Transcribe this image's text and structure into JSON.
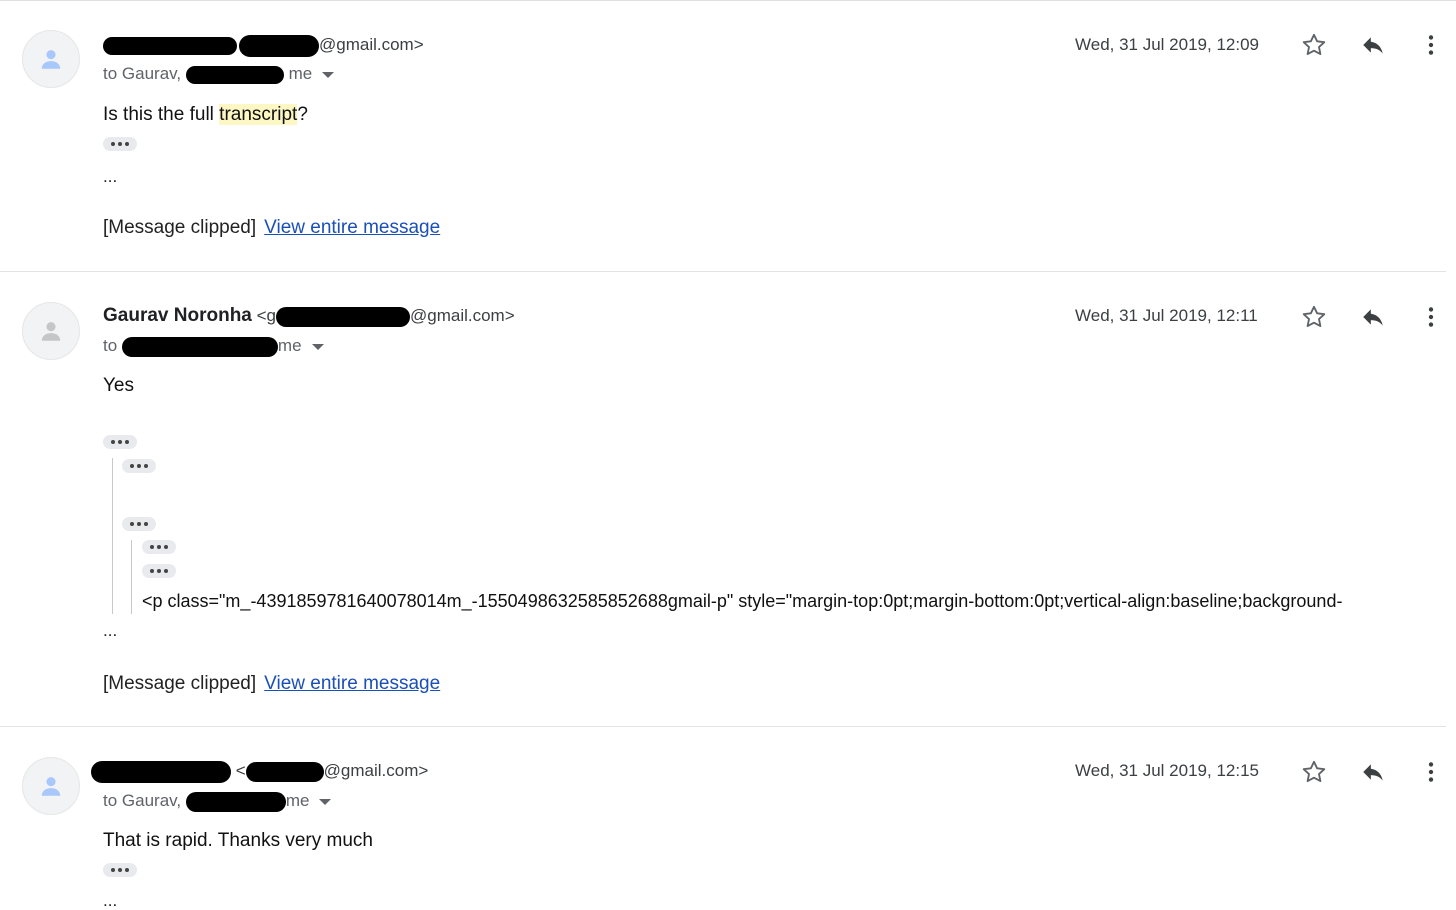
{
  "messages": [
    {
      "sender_name": "",
      "sender_email_suffix": "@gmail.com>",
      "to_prefix": "to Gaurav,",
      "to_me": "me",
      "date": "Wed, 31 Jul 2019, 12:09",
      "body_before": "Is this the full ",
      "body_highlight": "transcript",
      "body_after": "?",
      "ellipsis": "...",
      "clipped_label": "[Message clipped]",
      "view_link": "View entire message"
    },
    {
      "sender_name": "Gaurav Noronha",
      "sender_email_prefix": "<g",
      "sender_email_suffix": "@gmail.com>",
      "to_prefix": "to",
      "to_me": "me",
      "date": "Wed, 31 Jul 2019, 12:11",
      "body": "Yes",
      "quoted_code": "<p class=\"m_-4391859781640078014m_-1550498632585852688gmail-p\" style=\"margin-top:0pt;margin-bottom:0pt;vertical-align:baseline;background-",
      "ellipsis": "...",
      "clipped_label": "[Message clipped]",
      "view_link": "View entire message"
    },
    {
      "sender_name": "",
      "sender_email_prefix": "<",
      "sender_email_suffix": "@gmail.com>",
      "to_prefix": "to Gaurav,",
      "to_me": "me",
      "date": "Wed, 31 Jul 2019, 12:15",
      "body": "That is rapid. Thanks very much",
      "ellipsis": "..."
    }
  ],
  "colors": {
    "link": "#1a4fb6",
    "highlight": "#fdf7c3",
    "avatar_blue": "#a8c7fa",
    "avatar_grey": "#c4c7c5"
  },
  "icons": [
    "person-icon",
    "star-icon",
    "reply-icon",
    "more-vert-icon",
    "expand-dots-icon",
    "caret-down-icon"
  ]
}
